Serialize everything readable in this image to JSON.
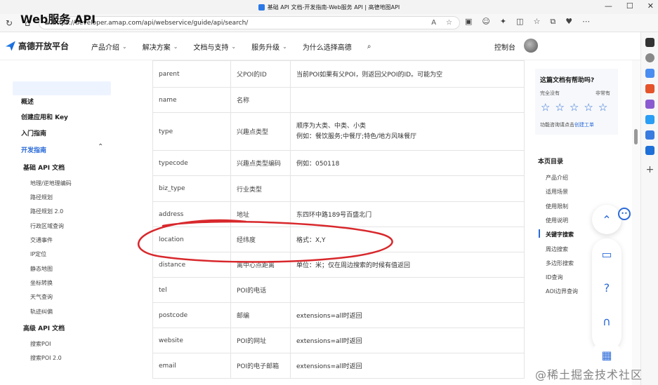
{
  "browser": {
    "tab_title": "基础 API 文档-开发指南-Web服务 API | 高德地图API",
    "url": "https://developer.amap.com/api/webservice/guide/api/search/"
  },
  "header": {
    "logo_text": "高德开放平台",
    "menu": [
      "产品介绍",
      "解决方案",
      "文档与支持",
      "服务升级",
      "为什么选择高德"
    ],
    "console": "控制台"
  },
  "sidebar": {
    "title": "Web服务 API",
    "items": [
      "概述",
      "创建应用和 Key",
      "入门指南"
    ],
    "active": "开发指南",
    "group1": "基础 API 文档",
    "group1_items": [
      "地理/逆地理编码",
      "路径规划",
      "路径规划 2.0",
      "行政区域查询",
      "交通事件",
      "IP定位",
      "静态地图",
      "坐标转换",
      "天气查询",
      "轨迹纠偏"
    ],
    "group2": "高级 API 文档",
    "group2_items": [
      "搜索POI",
      "搜索POI 2.0"
    ]
  },
  "table": {
    "rows": [
      {
        "name": "parent",
        "meaning": "父POI的ID",
        "desc": "当前POI如果有父POI，则返回父POI的ID。可能为空"
      },
      {
        "name": "name",
        "meaning": "名称",
        "desc": ""
      },
      {
        "name": "type",
        "meaning": "兴趣点类型",
        "desc": "顺序为大类、中类、小类",
        "desc2": "例如：餐饮服务;中餐厅;特色/地方风味餐厅"
      },
      {
        "name": "typecode",
        "meaning": "兴趣点类型编码",
        "desc": "例如：050118"
      },
      {
        "name": "biz_type",
        "meaning": "行业类型",
        "desc": ""
      },
      {
        "name": "address",
        "meaning": "地址",
        "desc": "东四环中路189号百盛北门"
      },
      {
        "name": "location",
        "meaning": "经纬度",
        "desc": "格式：X,Y"
      },
      {
        "name": "distance",
        "meaning": "离中心点距离",
        "desc": "单位：米；仅在周边搜索的时候有值返回"
      },
      {
        "name": "tel",
        "meaning": "POI的电话",
        "desc": ""
      },
      {
        "name": "postcode",
        "meaning": "邮编",
        "desc": "extensions=all时返回"
      },
      {
        "name": "website",
        "meaning": "POI的网址",
        "desc": "extensions=all时返回"
      },
      {
        "name": "email",
        "meaning": "POI的电子邮箱",
        "desc": "extensions=all时返回"
      }
    ]
  },
  "help": {
    "title": "这篇文档有帮助吗?",
    "left": "完全没有",
    "right": "非常有",
    "cta": "功能咨询请点击",
    "link": "创建工单"
  },
  "toc": {
    "title": "本页目录",
    "items": [
      "产品介绍",
      "适用场景",
      "使用限制",
      "使用说明",
      "关键字搜索",
      "周边搜索",
      "多边形搜索",
      "ID查询",
      "AOI边界查询"
    ]
  },
  "watermark": "@稀土掘金技术社区"
}
